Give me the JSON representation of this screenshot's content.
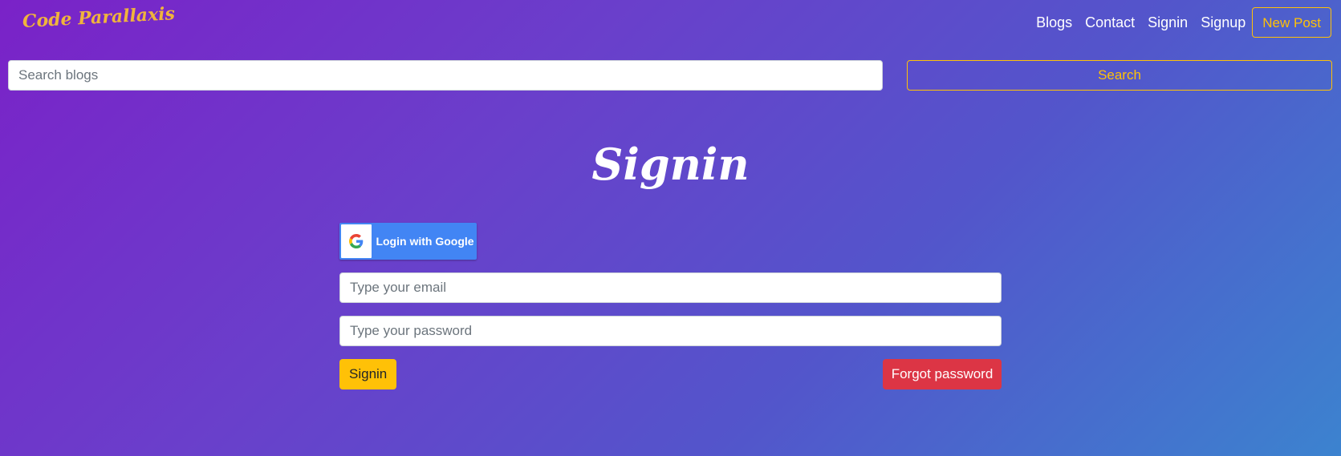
{
  "navbar": {
    "brand": "Code Parallaxis",
    "links": [
      "Blogs",
      "Contact",
      "Signin",
      "Signup"
    ],
    "new_post": "New Post"
  },
  "search": {
    "placeholder": "Search blogs",
    "value": "",
    "button": "Search"
  },
  "signin": {
    "title": "Signin",
    "google_label": "Login with Google",
    "google_icon": "google-g-icon",
    "email_placeholder": "Type your email",
    "password_placeholder": "Type your password",
    "submit_label": "Signin",
    "forgot_label": "Forgot password"
  },
  "colors": {
    "accent": "#ffc107",
    "danger": "#dc3545",
    "google_blue": "#4285f4",
    "brand": "#f0b43c"
  }
}
